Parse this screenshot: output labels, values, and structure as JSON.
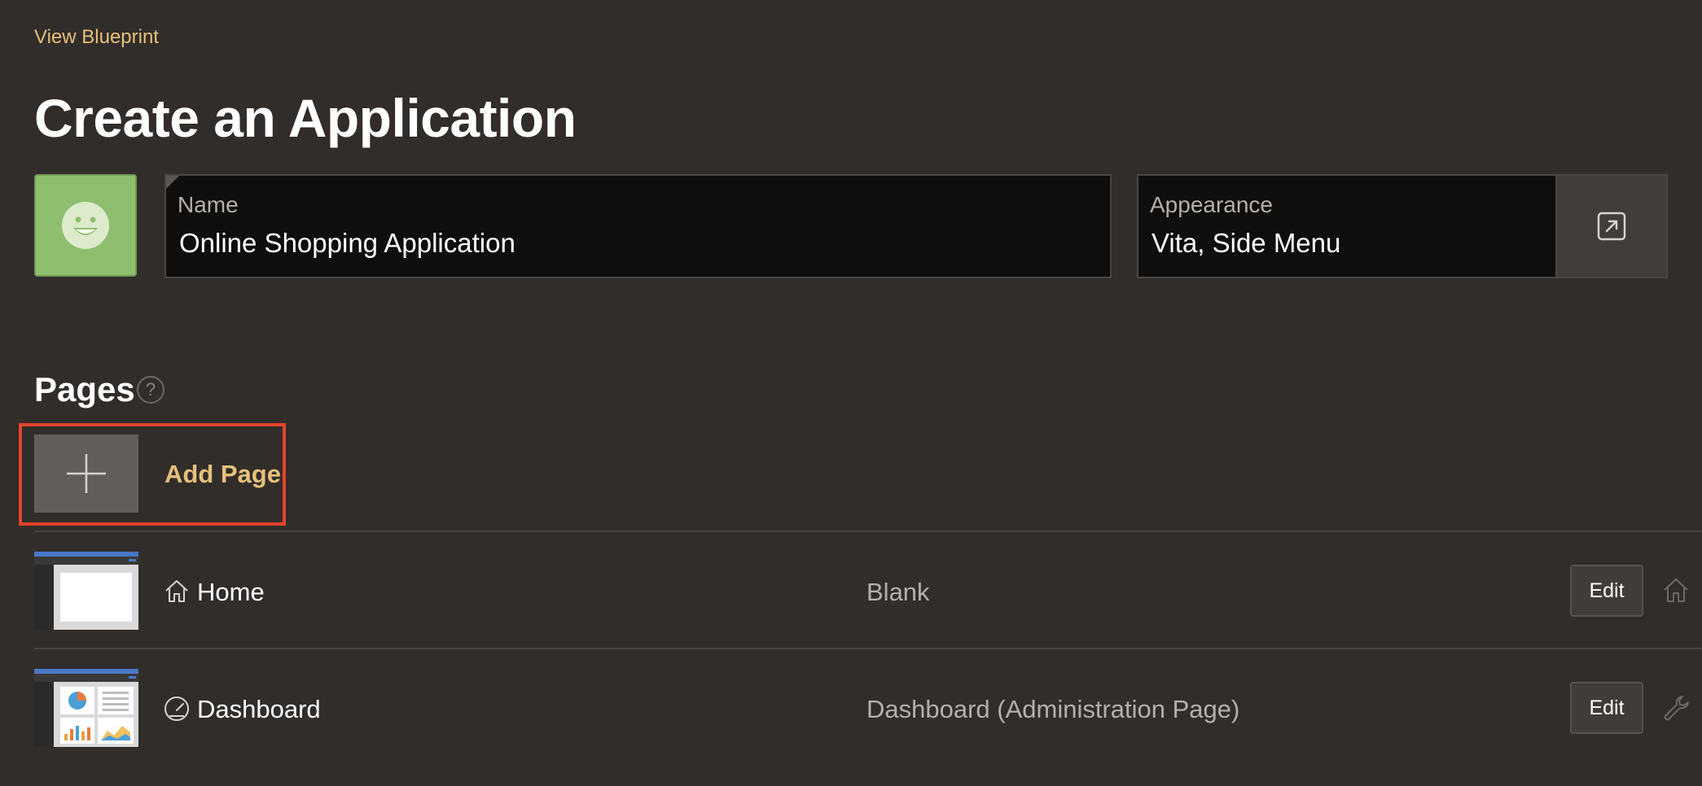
{
  "header": {
    "view_blueprint_link": "View Blueprint",
    "title": "Create an Application"
  },
  "app_icon": {
    "icon": "smiley-face-icon",
    "color": "#8fbf6e"
  },
  "name_field": {
    "label": "Name",
    "value": "Online Shopping Application"
  },
  "appearance_field": {
    "label": "Appearance",
    "value": "Vita, Side Menu",
    "button_icon": "external-link-icon"
  },
  "pages": {
    "title": "Pages",
    "help_icon": "?",
    "add_page_label": "Add Page",
    "rows": [
      {
        "name": "Home",
        "icon": "home-icon",
        "type": "Blank",
        "edit_label": "Edit",
        "right_icon": "home-icon"
      },
      {
        "name": "Dashboard",
        "icon": "dashboard-gauge-icon",
        "type": "Dashboard (Administration Page)",
        "edit_label": "Edit",
        "right_icon": "wrench-icon"
      }
    ]
  },
  "colors": {
    "background": "#312d2a",
    "accent_link": "#e6c07b",
    "highlight_border": "#e2452e",
    "field_bg": "#0f0e0d"
  }
}
